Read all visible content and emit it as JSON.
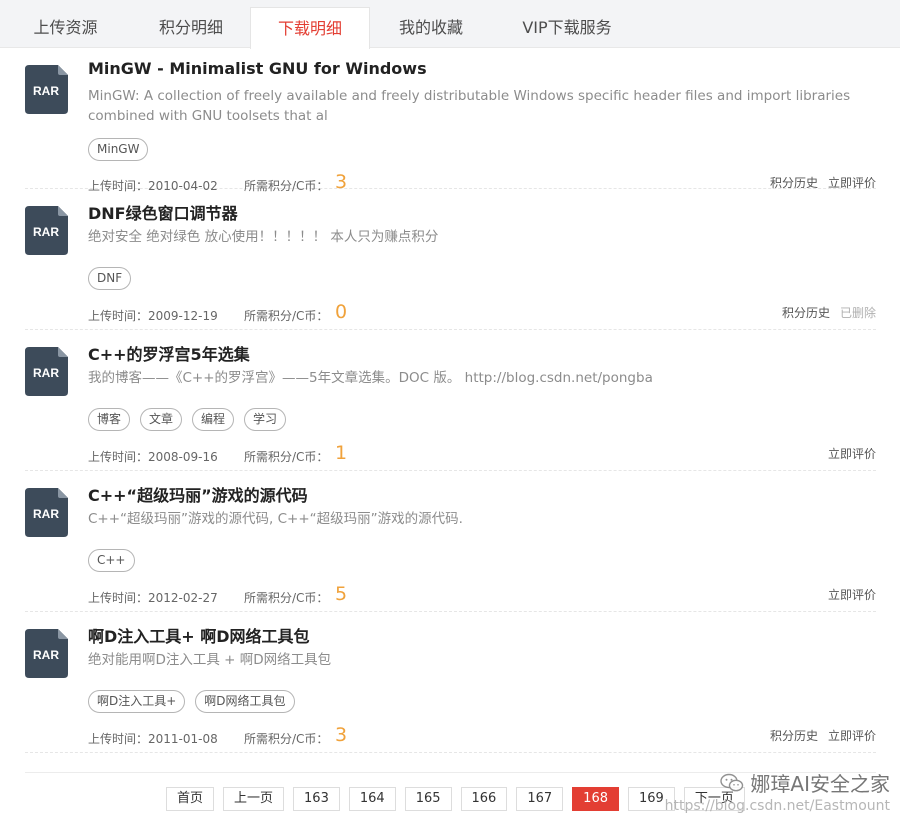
{
  "tabs": [
    "上传资源",
    "积分明细",
    "下载明细",
    "我的收藏",
    "VIP下载服务"
  ],
  "active_tab_index": 2,
  "file_icon_label": "RAR",
  "items": [
    {
      "title": "MinGW - Minimalist GNU for Windows",
      "desc": "MinGW: A collection of freely available and freely distributable Windows specific header files and import libraries combined with GNU toolsets that al",
      "tags": [
        "MinGW"
      ],
      "upload_label": "上传时间：",
      "upload_date": "2010-04-02",
      "cost_label": "所需积分/C币：",
      "cost": "3",
      "actions": [
        {
          "label": "积分历史",
          "disabled": false
        },
        {
          "label": "立即评价",
          "disabled": false
        }
      ]
    },
    {
      "title": "DNF绿色窗口调节器",
      "desc": "绝对安全 绝对绿色 放心使用！！！！！ 本人只为赚点积分",
      "tags": [
        "DNF"
      ],
      "upload_label": "上传时间：",
      "upload_date": "2009-12-19",
      "cost_label": "所需积分/C币：",
      "cost": "0",
      "actions": [
        {
          "label": "积分历史",
          "disabled": false
        },
        {
          "label": "已删除",
          "disabled": true
        }
      ]
    },
    {
      "title": "C++的罗浮宫5年选集",
      "desc": "我的博客——《C++的罗浮宫》——5年文章选集。DOC 版。 http://blog.csdn.net/pongba",
      "tags": [
        "博客",
        "文章",
        "编程",
        "学习"
      ],
      "upload_label": "上传时间：",
      "upload_date": "2008-09-16",
      "cost_label": "所需积分/C币：",
      "cost": "1",
      "actions": [
        {
          "label": "立即评价",
          "disabled": false
        }
      ]
    },
    {
      "title": "C++“超级玛丽”游戏的源代码",
      "desc": "C++“超级玛丽”游戏的源代码, C++“超级玛丽”游戏的源代码.",
      "tags": [
        "C++"
      ],
      "upload_label": "上传时间：",
      "upload_date": "2012-02-27",
      "cost_label": "所需积分/C币：",
      "cost": "5",
      "actions": [
        {
          "label": "立即评价",
          "disabled": false
        }
      ]
    },
    {
      "title": "啊D注入工具+ 啊D网络工具包",
      "desc": "绝对能用啊D注入工具 + 啊D网络工具包",
      "tags": [
        "啊D注入工具+",
        "啊D网络工具包"
      ],
      "upload_label": "上传时间：",
      "upload_date": "2011-01-08",
      "cost_label": "所需积分/C币：",
      "cost": "3",
      "actions": [
        {
          "label": "积分历史",
          "disabled": false
        },
        {
          "label": "立即评价",
          "disabled": false
        }
      ]
    }
  ],
  "pagination": {
    "first": "首页",
    "prev": "上一页",
    "pages": [
      "163",
      "164",
      "165",
      "166",
      "167",
      "168",
      "169"
    ],
    "current": "168",
    "next": "下一页"
  },
  "watermark": {
    "brand": "娜璋AI安全之家",
    "url": "https://blog.csdn.net/Eastmount"
  },
  "colors": {
    "accent": "#e33e33",
    "cost": "#f0a23b",
    "file_icon": "#3d4b5a"
  }
}
